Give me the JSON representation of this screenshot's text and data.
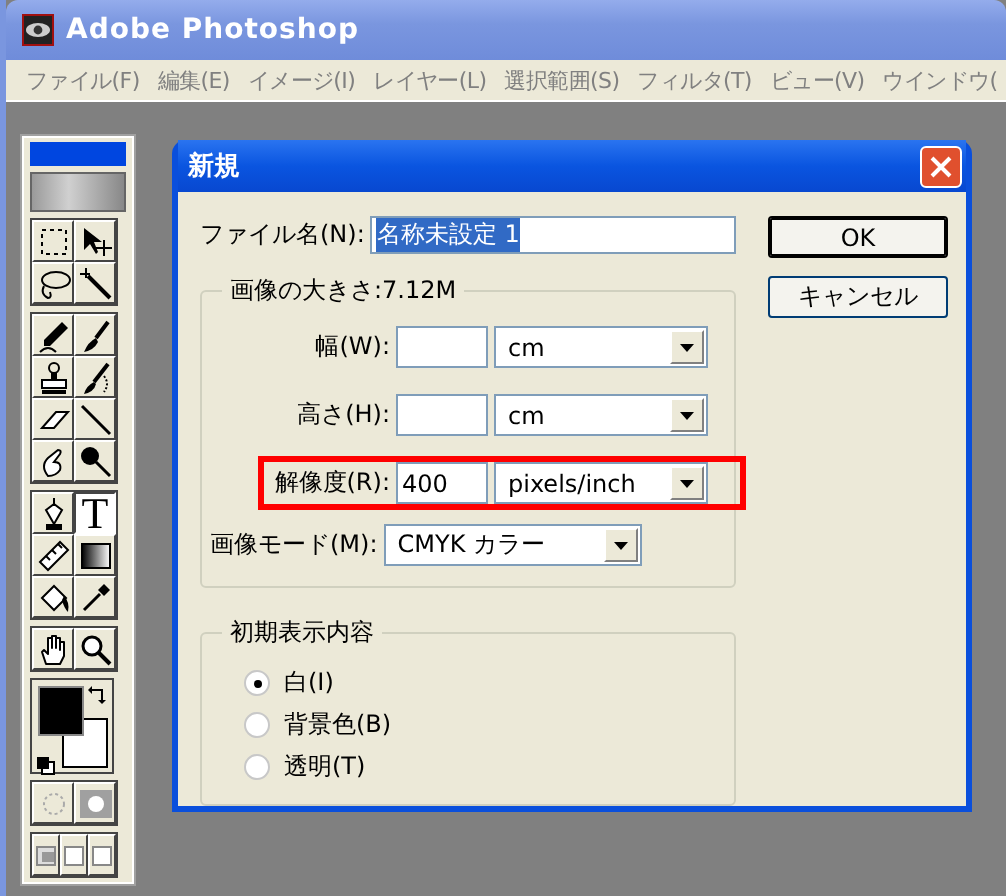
{
  "app": {
    "title": "Adobe Photoshop"
  },
  "menu": [
    "ファイル(F)",
    "編集(E)",
    "イメージ(I)",
    "レイヤー(L)",
    "選択範囲(S)",
    "フィルタ(T)",
    "ビュー(V)",
    "ウインドウ("
  ],
  "toolbox": {
    "tools": [
      {
        "selected": false
      },
      {
        "selected": false
      },
      {
        "selected": false
      },
      {
        "selected": false
      },
      {
        "selected": false
      },
      {
        "selected": false
      },
      {
        "selected": false
      },
      {
        "selected": false
      },
      {
        "selected": false
      },
      {
        "selected": false
      },
      {
        "selected": false
      },
      {
        "selected": false
      },
      {
        "selected": false
      },
      {
        "selected": true,
        "glyph": "T"
      },
      {
        "selected": false
      },
      {
        "selected": false
      },
      {
        "selected": false
      },
      {
        "selected": false
      },
      {
        "selected": false
      },
      {
        "selected": false
      }
    ]
  },
  "dialog": {
    "title": "新規",
    "name_label": "ファイル名(N):",
    "name_value": "名称未設定 1",
    "name_selected": true,
    "size_group": {
      "title": "画像の大きさ:7.12M",
      "fields": [
        {
          "label": "幅(W):",
          "unit": "cm",
          "highlighted": false
        },
        {
          "label": "高さ(H):",
          "unit": "cm",
          "highlighted": false
        },
        {
          "label": "解像度(R):",
          "value": "400",
          "unit": "pixels/inch",
          "highlighted": true
        }
      ],
      "mode": {
        "label": "画像モード(M):",
        "value": "CMYK カラー"
      }
    },
    "contents_group": {
      "title": "初期表示内容",
      "options": [
        {
          "label": "白(I)",
          "selected": true
        },
        {
          "label": "背景色(B)",
          "selected": false
        },
        {
          "label": "透明(T)",
          "selected": false
        }
      ]
    },
    "buttons": [
      {
        "label": "OK",
        "default": true
      },
      {
        "label": "キャンセル",
        "default": false
      }
    ]
  }
}
